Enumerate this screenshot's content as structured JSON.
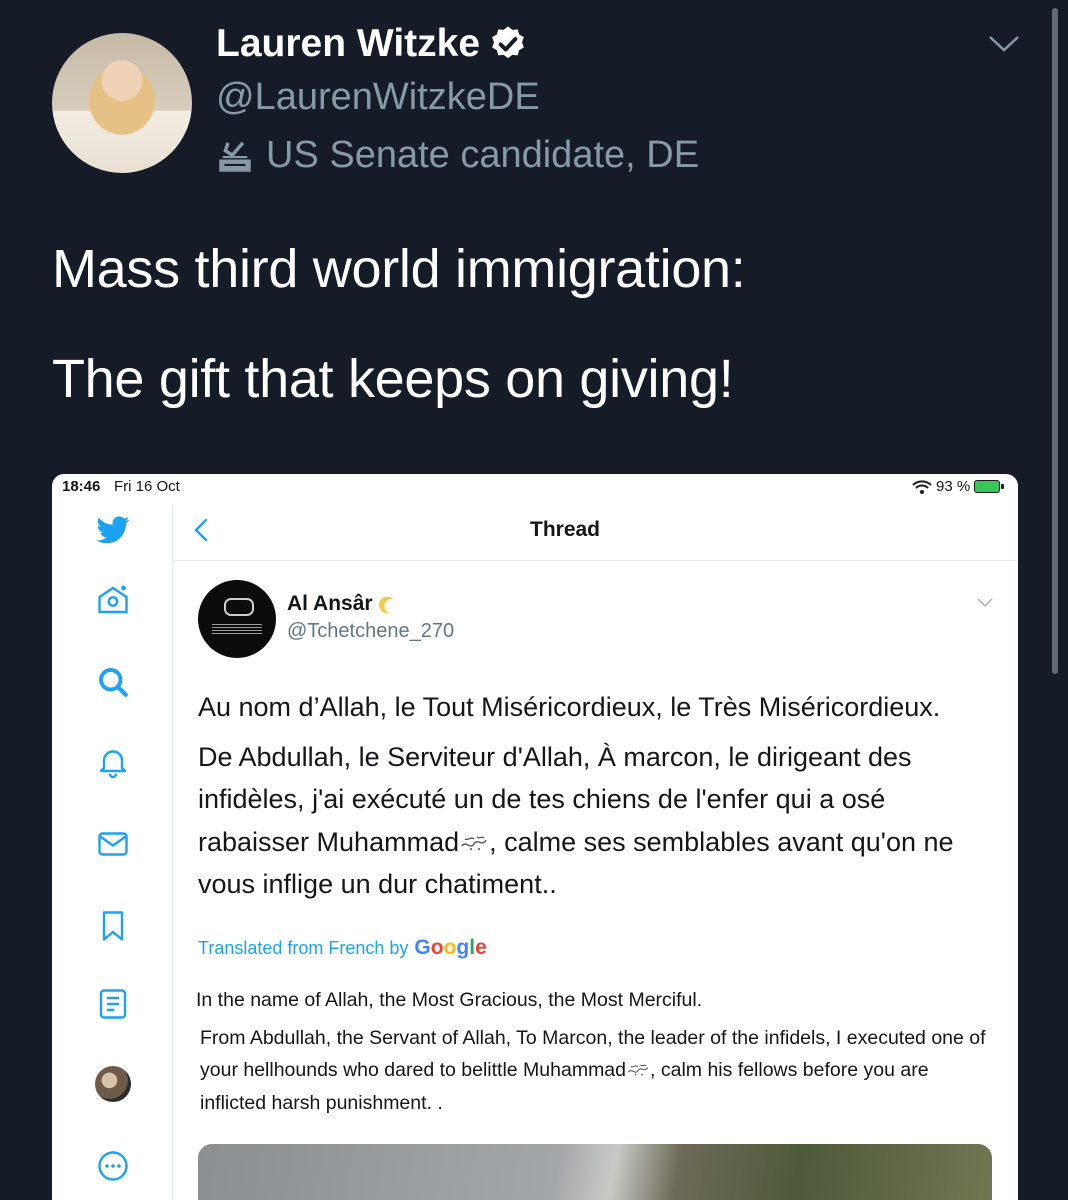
{
  "tweet": {
    "author": {
      "display_name": "Lauren Witzke",
      "handle": "@LaurenWitzkeDE",
      "bio": "US Senate candidate, DE",
      "verified": true
    },
    "text_lines": [
      "Mass third world immigration:",
      "The gift that keeps on giving!"
    ]
  },
  "screenshot": {
    "status_bar": {
      "time": "18:46",
      "date": "Fri 16 Oct",
      "battery": "93 %"
    },
    "header": {
      "title": "Thread"
    },
    "sidebar_icons": [
      "twitter-logo",
      "home",
      "search",
      "notifications",
      "messages",
      "bookmarks",
      "lists",
      "profile",
      "more"
    ],
    "post": {
      "author_name": "Al Ansâr",
      "author_handle": "@Tchetchene_270",
      "original_paragraphs": [
        "Au nom d’Allah, le Tout Miséricordieux, le Très Miséricordieux.",
        "De Abdullah, le Serviteur d'Allah, À marcon, le dirigeant des infidèles, j'ai exécuté un de tes chiens de l'enfer qui a osé rabaisser Muhammad",
        ", calme ses semblables avant qu'on ne vous inflige un dur chatiment.."
      ],
      "translation_label": "Translated from French by",
      "translation_provider": "Google",
      "translated_paragraphs": [
        "In the name of Allah, the Most Gracious, the Most Merciful.",
        "From Abdullah, the Servant of Allah, To Marcon, the leader of the infidels, I executed one of your hellhounds who dared to belittle Muhammad",
        ", calm his fellows before you are inflicted harsh punishment. ."
      ]
    }
  },
  "colors": {
    "background": "#151c27",
    "primary_text": "#ffffff",
    "secondary_text": "#8899a6",
    "twitter_blue": "#1da1f2"
  }
}
